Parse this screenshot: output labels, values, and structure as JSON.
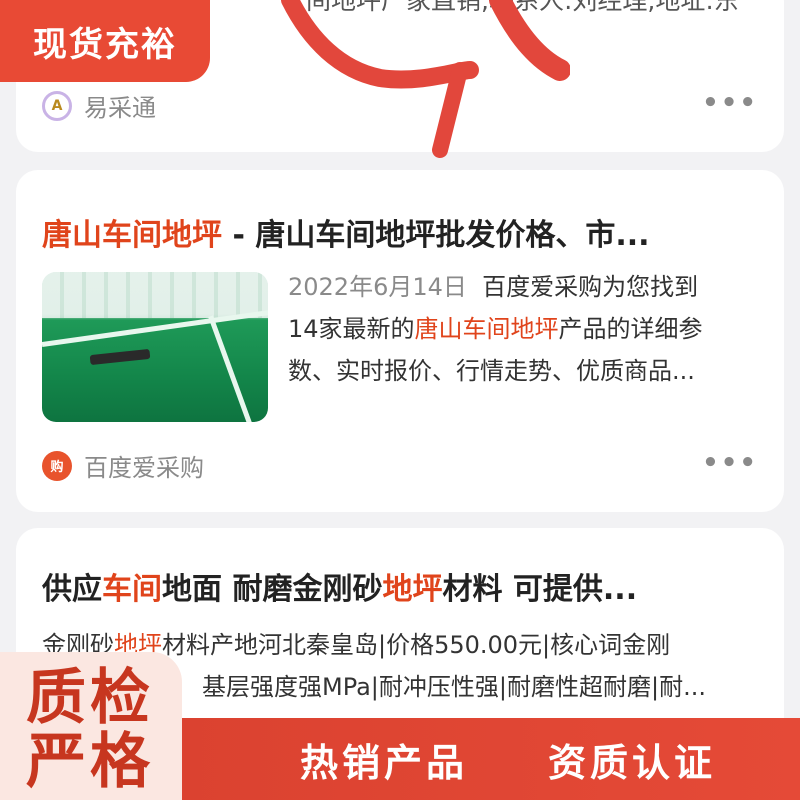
{
  "card1": {
    "snippet_line": "间地坪厂家直销,联系人:刘经理,地址:东",
    "source": {
      "icon": "yicaitong-logo-icon",
      "icon_text": "A",
      "name": "易采通"
    }
  },
  "card2": {
    "title_highlight": "唐山车间地坪",
    "title_rest": " - 唐山车间地坪批发价格、市...",
    "date": "2022年6月14日",
    "desc_a": "百度爱采购为您找到",
    "desc_b": "14家最新的",
    "desc_highlight": "唐山车间地坪",
    "desc_c": "产品的详细参",
    "desc_d": "数、实时报价、行情走势、优质商品...",
    "source": {
      "icon": "baidu-aicaigou-icon",
      "icon_text": "购",
      "name": "百度爱采购"
    }
  },
  "card3": {
    "title_parts": [
      "供应",
      "车间",
      "地面 耐磨金刚砂",
      "地坪",
      "材料 可提供..."
    ],
    "desc_line1_parts": [
      "金刚砂",
      "地坪",
      "材料产地河北秦皇岛|价格550.00元|核心词金刚"
    ],
    "desc_line2": "基层强度强MPa|耐冲压性强|耐磨性超耐磨|耐..."
  },
  "overlays": {
    "top_left_badge": "现货充裕",
    "quality_line1": "质检",
    "quality_line2": "严格",
    "bottom_left_text": "热销产品",
    "bottom_right_text": "资质认证"
  },
  "more_icon_glyph": "•••",
  "colors": {
    "highlight": "#e0441b",
    "promo_red": "#e84a35",
    "background": "#f2f2f4"
  }
}
